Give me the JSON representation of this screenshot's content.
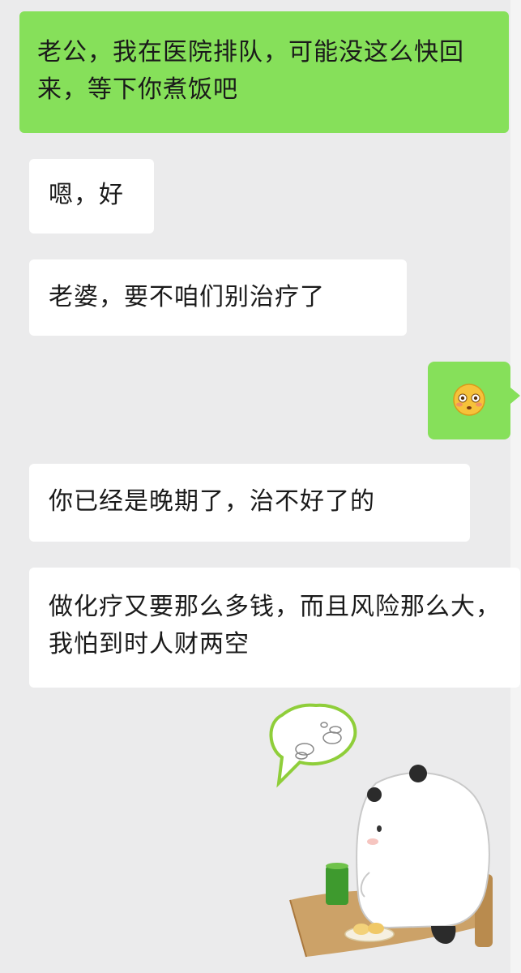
{
  "chat": {
    "messages": [
      {
        "text": "老公，我在医院排队，可能没这么快回来，等下你煮饭吧",
        "side": "right",
        "bubble_color": "#86e05a"
      },
      {
        "text": "嗯，好",
        "side": "left",
        "bubble_color": "#ffffff"
      },
      {
        "text": "老婆，要不咱们别治疗了",
        "side": "left",
        "bubble_color": "#ffffff"
      },
      {
        "emoji": "flushed-face-icon",
        "side": "right",
        "bubble_color": "#86e05a"
      },
      {
        "text": "你已经是晚期了，治不好了的",
        "side": "left",
        "bubble_color": "#ffffff"
      },
      {
        "text": "做化疗又要那么多钱，而且风险那么大，我怕到时人财两空",
        "side": "left",
        "bubble_color": "#ffffff"
      }
    ],
    "sticker": {
      "icon": "panda-thinking-sticker"
    }
  },
  "colors": {
    "background": "#ebebec",
    "sent_bubble": "#86e05a",
    "received_bubble": "#ffffff"
  }
}
